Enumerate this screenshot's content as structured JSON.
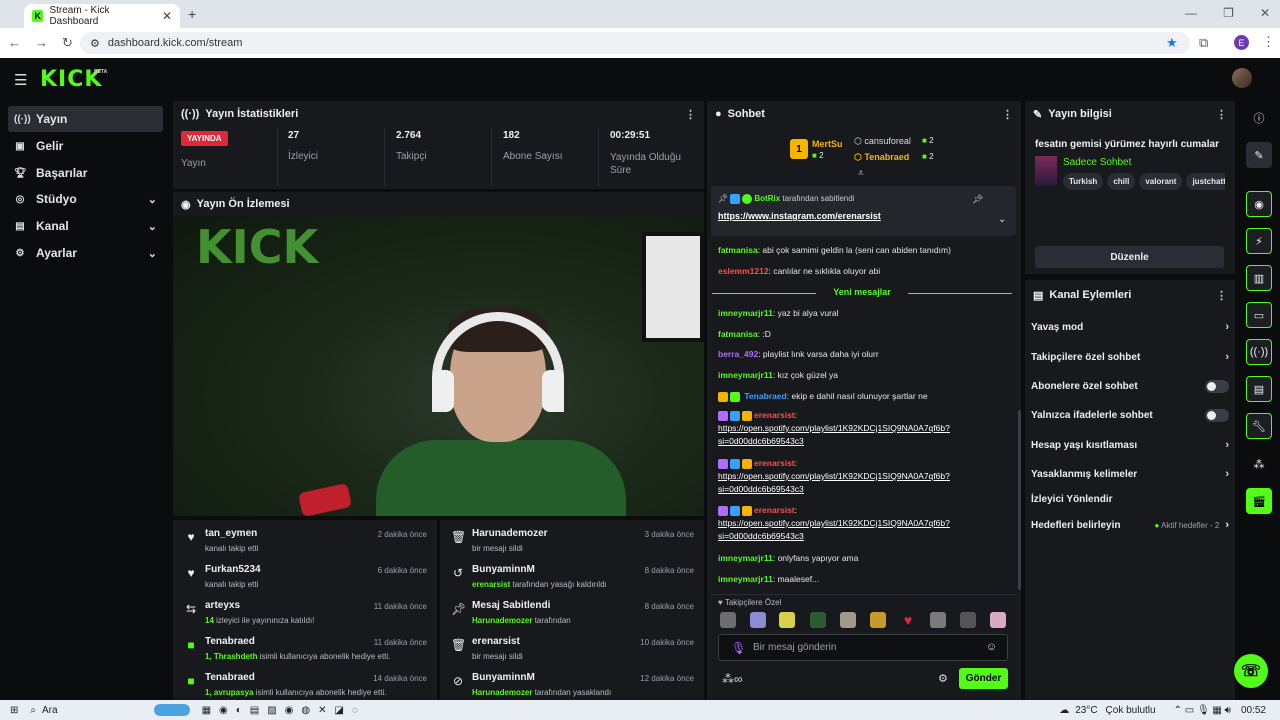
{
  "browser": {
    "tab_title": "Stream - Kick Dashboard",
    "url": "dashboard.kick.com/stream",
    "profile_initial": "E"
  },
  "brand": {
    "logo": "KICK",
    "beta": "BETA",
    "accent": "#53fc18"
  },
  "sidebar": {
    "items": [
      {
        "label": "Yayın",
        "icon": "broadcast-icon"
      },
      {
        "label": "Gelir",
        "icon": "revenue-icon"
      },
      {
        "label": "Başarılar",
        "icon": "trophy-icon"
      },
      {
        "label": "Stüdyo",
        "icon": "studio-icon"
      },
      {
        "label": "Kanal",
        "icon": "channel-icon"
      },
      {
        "label": "Ayarlar",
        "icon": "settings-icon"
      }
    ]
  },
  "stats": {
    "title": "Yayın İstatistikleri",
    "live_badge": "YAYINDA",
    "live_label": "Yayın",
    "viewers": {
      "value": "27",
      "label": "İzleyici"
    },
    "followers": {
      "value": "2.764",
      "label": "Takipçi"
    },
    "subs": {
      "value": "182",
      "label": "Abone Sayısı"
    },
    "duration": {
      "value": "00:29:51",
      "label": "Yayında Olduğu Süre"
    }
  },
  "preview": {
    "title": "Yayın Ön İzlemesi"
  },
  "feed_left": [
    {
      "name": "tan_eymen",
      "sub": "kanalı takip etti",
      "time": "2 dakika önce",
      "icon": "heart-icon"
    },
    {
      "name": "Furkan5234",
      "sub": "kanalı takip etti",
      "time": "6 dakika önce",
      "icon": "heart-icon"
    },
    {
      "name": "arteyxs",
      "sub_b": "14",
      "sub": " izleyici ile yayınınıza katıldı!",
      "time": "11 dakika önce",
      "icon": "raid-icon"
    },
    {
      "name": "Tenabraed",
      "sub_b": "1, Thrashdeth",
      "sub": " isimli kullanıcıya abonelik hediye etti.",
      "time": "11 dakika önce",
      "icon": "gift-icon"
    },
    {
      "name": "Tenabraed",
      "sub_b": "1, avrupasya",
      "sub": " isimli kullanıcıya abonelik hediye etti.",
      "time": "14 dakika önce",
      "icon": "gift-icon"
    }
  ],
  "feed_right": [
    {
      "name": "Harunademozer",
      "sub": "bir mesajı sildi",
      "time": "3 dakika önce",
      "icon": "trash-icon"
    },
    {
      "name": "BunyaminnM",
      "sub_b": "erenarsist",
      "sub": " tarafından yasağı kaldırıldı",
      "time": "8 dakika önce",
      "icon": "undo-icon"
    },
    {
      "name": "Mesaj Sabitlendi",
      "sub_b": "Harunademozer",
      "sub": " tarafından",
      "time": "8 dakika önce",
      "icon": "pin-icon"
    },
    {
      "name": "erenarsist",
      "sub": "bir mesajı sildi",
      "time": "10 dakika önce",
      "icon": "trash-icon"
    },
    {
      "name": "BunyaminnM",
      "sub_b": "Harunademozer",
      "sub": " tarafından yasaklandı",
      "time": "12 dakika önce",
      "icon": "ban-icon"
    }
  ],
  "chat": {
    "title": "Sohbet",
    "top_gifter": {
      "rank": "1",
      "name": "MertSu",
      "count": "2"
    },
    "gifters": [
      {
        "name": "cansuforeal",
        "count": "2"
      },
      {
        "name": "Tenabraed",
        "count": "2"
      }
    ],
    "pinned": {
      "by": "BotRix",
      "by_suffix": "tarafından sabitlendi",
      "link": "https://www.instagram.com/erenarsist"
    },
    "new_messages": "Yeni mesajlar",
    "messages": [
      {
        "user": "fatmanisa",
        "color": "#53fc18",
        "text": "abi çok samimi geldin la (seni can abiden tanıdım)"
      },
      {
        "user": "eslemm1212",
        "color": "#ff4d4d",
        "text": "canlılar ne sıklıkla oluyor abi"
      },
      {
        "user": "imneymarjr11",
        "color": "#53fc18",
        "text": "yaz bi alya vural"
      },
      {
        "user": "fatmanisa",
        "color": "#53fc18",
        "text": ":D"
      },
      {
        "user": "berra_492",
        "color": "#b36bff",
        "text": "playlist lınk varsa daha iyi olurr"
      },
      {
        "user": "imneymarjr11",
        "color": "#53fc18",
        "text": "kız çok güzel ya"
      },
      {
        "user": "Tenabraed",
        "color": "#3aa0ff",
        "text": "ekip e dahil nasıl olunuyor şartlar ne"
      },
      {
        "user": "erenarsist",
        "color": "#ff4d4d",
        "text": "https://open.spotify.com/playlist/1K92KDCj1SIQ9NA0A7qf6b?si=0d00ddc6b69543c3"
      },
      {
        "user": "erenarsist",
        "color": "#ff4d4d",
        "text": "https://open.spotify.com/playlist/1K92KDCj1SIQ9NA0A7qf6b?si=0d00ddc6b69543c3"
      },
      {
        "user": "erenarsist",
        "color": "#ff4d4d",
        "text": "https://open.spotify.com/playlist/1K92KDCj1SIQ9NA0A7qf6b?si=0d00ddc6b69543c3"
      },
      {
        "user": "imneymarjr11",
        "color": "#53fc18",
        "text": "onlyfans yapıyor ama"
      },
      {
        "user": "imneymarjr11",
        "color": "#53fc18",
        "text": "maalesef..."
      }
    ],
    "emote_section": "Takipçilere Özel",
    "input_placeholder": "Bir mesaj gönderin",
    "send": "Gönder"
  },
  "info": {
    "title": "Yayın bilgisi",
    "stream_title": "fesatın gemisi yürümez hayırlı cumalar",
    "category": "Sadece Sohbet",
    "tags": [
      "Turkish",
      "chill",
      "valorant",
      "justchatt"
    ],
    "edit": "Düzenle"
  },
  "actions": {
    "title": "Kanal Eylemleri",
    "items": [
      {
        "label": "Yavaş mod",
        "kind": "arrow"
      },
      {
        "label": "Takipçilere özel sohbet",
        "kind": "arrow"
      },
      {
        "label": "Abonelere özel sohbet",
        "kind": "toggle"
      },
      {
        "label": "Yalnızca ifadelerle sohbet",
        "kind": "toggle"
      },
      {
        "label": "Hesap yaşı kısıtlaması",
        "kind": "arrow"
      },
      {
        "label": "Yasaklanmış kelimeler",
        "kind": "arrow"
      },
      {
        "label": "İzleyici Yönlendir",
        "kind": "none"
      },
      {
        "label": "Hedefleri belirleyin",
        "kind": "arrow",
        "extra": "Aktif hedefler - 2"
      }
    ]
  },
  "taskbar": {
    "search": "Ara",
    "weather": "23°C",
    "weather_text": "Çok bulutlu",
    "time": "00:52"
  }
}
